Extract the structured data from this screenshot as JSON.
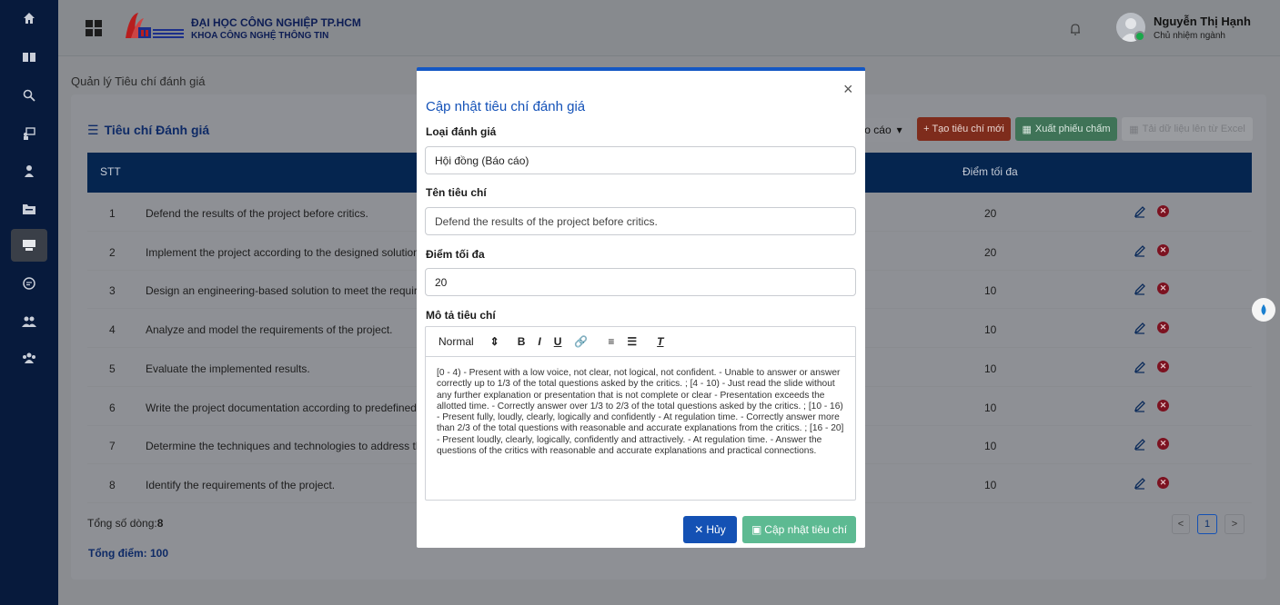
{
  "header": {
    "university": "ĐẠI HỌC CÔNG NGHIỆP TP.HCM",
    "department": "KHOA CÔNG NGHỆ THÔNG TIN",
    "user_name": "Nguyễn Thị Hạnh",
    "user_role": "Chủ nhiệm ngành"
  },
  "sidebar": {
    "icons": [
      "home-icon",
      "book-icon",
      "search-icon",
      "teacher-icon",
      "student-icon",
      "folder-icon",
      "presentation-icon",
      "chat-icon",
      "users-icon",
      "group-icon"
    ],
    "active_index": 6
  },
  "page": {
    "title": "Quản lý Tiêu chí đánh giá",
    "card_title": "Tiêu chí Đánh giá",
    "filter_value": "o cáo",
    "create_label": "+ Tạo tiêu chí mới",
    "export_label": "Xuất phiếu chấm",
    "upload_label": "Tải dữ liệu lên từ Excel"
  },
  "table": {
    "headers": {
      "stt": "STT",
      "max": "Điểm tối đa"
    },
    "rows": [
      {
        "n": "1",
        "criterion": "Defend the results of the project before critics.",
        "points": "20"
      },
      {
        "n": "2",
        "criterion": "Implement the project according to the designed solution.",
        "points": "20"
      },
      {
        "n": "3",
        "criterion": "Design an engineering-based solution to meet the requirem",
        "points": "10"
      },
      {
        "n": "4",
        "criterion": "Analyze and model the requirements of the project.",
        "points": "10"
      },
      {
        "n": "5",
        "criterion": "Evaluate the implemented results.",
        "points": "10"
      },
      {
        "n": "6",
        "criterion": "Write the project documentation according to predefined re",
        "points": "10"
      },
      {
        "n": "7",
        "criterion": "Determine the techniques and technologies to address the",
        "points": "10"
      },
      {
        "n": "8",
        "criterion": "Identify the requirements of the project.",
        "points": "10"
      }
    ]
  },
  "footer": {
    "rows_label": "Tổng số dòng:",
    "rows_count": "8",
    "total_label": "Tổng điểm: 100",
    "page_prev": "<",
    "page_current": "1",
    "page_next": ">"
  },
  "modal": {
    "title": "Cập nhật tiêu chí đánh giá",
    "type_label": "Loại đánh giá",
    "type_value": "Hội đồng (Báo cáo)",
    "name_label": "Tên tiêu chí",
    "name_value": "Defend the results of the project before critics.",
    "max_label": "Điểm tối đa",
    "max_value": "20",
    "desc_label": "Mô tả tiêu chí",
    "format_value": "Normal",
    "description": "[0 - 4) - Present with a low voice, not clear, not logical, not confident. - Unable to answer or answer correctly up to 1/3 of the total questions asked by the critics. ; [4 - 10) - Just read the slide without any further explanation or presentation that is not complete or clear - Presentation exceeds the allotted time. - Correctly answer over 1/3 to 2/3 of the total questions asked by the critics. ; [10 - 16) - Present fully, loudly, clearly, logically and confidently - At regulation time. - Correctly answer more than 2/3 of the total questions with reasonable and accurate explanations from the critics. ; [16 - 20] - Present loudly, clearly, logically, confidently and attractively. - At regulation time. - Answer the questions of the critics with reasonable and accurate explanations and practical connections.",
    "cancel_label": "Hủy",
    "update_label": "Cập nhật tiêu chí"
  },
  "colors": {
    "sidebar": "#071a3c",
    "table_header": "#05254f",
    "modal_accent": "#1457c4",
    "update_button": "#5dba92",
    "cancel_button": "#1451b4"
  }
}
